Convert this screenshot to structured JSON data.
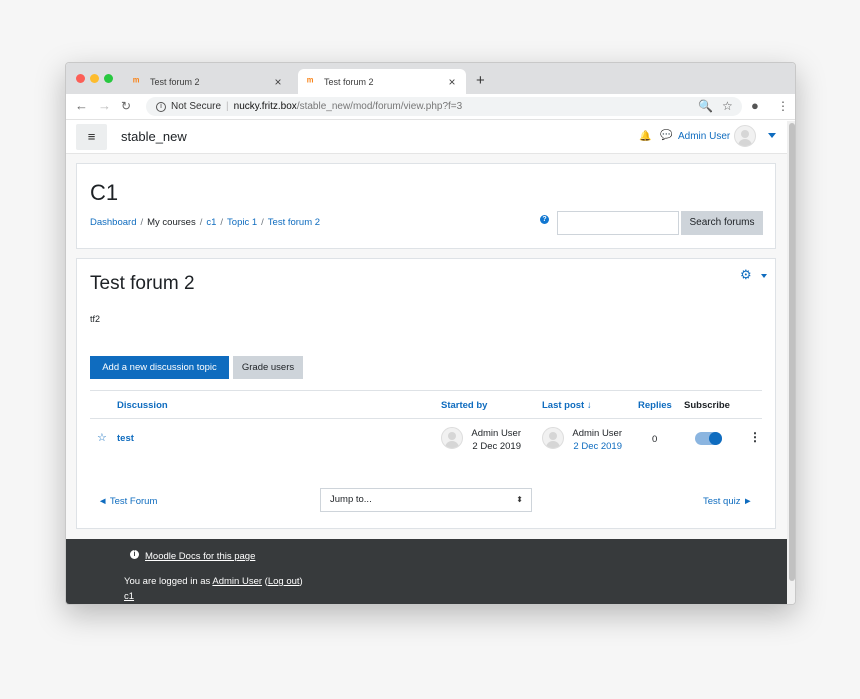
{
  "browser": {
    "tabs": [
      {
        "title": "Test forum 2"
      },
      {
        "title": "Test forum 2"
      }
    ],
    "new_tab": "+",
    "security_label": "Not Secure",
    "url_host": "nucky.fritz.box",
    "url_path": "/stable_new/mod/forum/view.php?f=3"
  },
  "navbar": {
    "site_name": "stable_new",
    "user_name": "Admin User"
  },
  "header": {
    "course_title": "C1",
    "breadcrumbs": [
      "Dashboard",
      "My courses",
      "c1",
      "Topic 1",
      "Test forum 2"
    ],
    "search_button": "Search forums",
    "search_placeholder": ""
  },
  "forum": {
    "title": "Test forum 2",
    "intro": "tf2",
    "add_button": "Add a new discussion topic",
    "grade_button": "Grade users",
    "columns": {
      "discussion": "Discussion",
      "started_by": "Started by",
      "last_post": "Last post",
      "sort_arrow": "↓",
      "replies": "Replies",
      "subscribe": "Subscribe"
    },
    "rows": [
      {
        "name": "test",
        "started_by_name": "Admin User",
        "started_by_date": "2 Dec 2019",
        "last_post_name": "Admin User",
        "last_post_date": "2 Dec 2019",
        "replies": "0",
        "subscribed": true
      }
    ],
    "prev_link": "◄ Test Forum",
    "jump_to": "Jump to...",
    "next_link": "Test quiz ►"
  },
  "footer": {
    "docs_link": "Moodle Docs for this page",
    "logged_in_prefix": "You are logged in as ",
    "logged_in_user": "Admin User",
    "logout_open": " (",
    "logout": "Log out",
    "logout_close": ")",
    "course_link": "c1"
  },
  "colors": {
    "brand": "#0f6cbf",
    "footer_bg": "#373a3c"
  }
}
